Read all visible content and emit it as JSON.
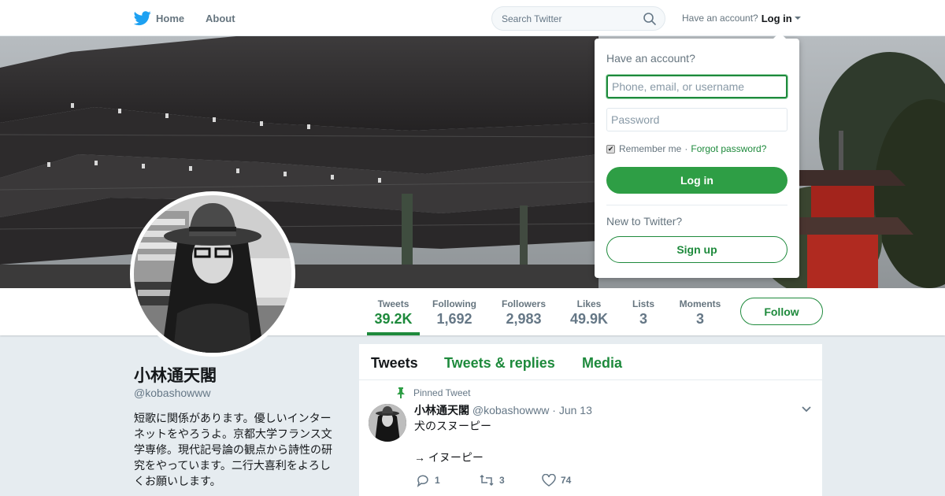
{
  "nav": {
    "home_label": "Home",
    "about_label": "About",
    "search_placeholder": "Search Twitter",
    "have_account": "Have an account?",
    "login_label": "Log in"
  },
  "profile_nav": {
    "stats": [
      {
        "label": "Tweets",
        "value": "39.2K"
      },
      {
        "label": "Following",
        "value": "1,692"
      },
      {
        "label": "Followers",
        "value": "2,983"
      },
      {
        "label": "Likes",
        "value": "49.9K"
      },
      {
        "label": "Lists",
        "value": "3"
      },
      {
        "label": "Moments",
        "value": "3"
      }
    ],
    "follow_label": "Follow"
  },
  "profile": {
    "name": "小林通天閣",
    "handle": "@kobashowww",
    "bio": "短歌に関係があります。優しいインターネットをやろうよ。京都大学フランス文学専修。現代記号論の観点から詩性の研究をやっています。二行大喜利をよろしくお願いします。"
  },
  "timeline": {
    "tabs": [
      "Tweets",
      "Tweets & replies",
      "Media"
    ],
    "tweet": {
      "pinned_label": "Pinned Tweet",
      "fullname": "小林通天閣",
      "handle": "@kobashowww",
      "dot": "·",
      "date": "Jun 13",
      "lines": [
        "犬のスヌーピー",
        "",
        "→ イヌーピー"
      ],
      "reply_count": "1",
      "retweet_count": "3",
      "like_count": "74"
    }
  },
  "login_dropdown": {
    "title": "Have an account?",
    "username_placeholder": "Phone, email, or username",
    "password_placeholder": "Password",
    "remember_label": "Remember me",
    "separator": "·",
    "forgot_label": "Forgot password?",
    "login_button": "Log in",
    "new_label": "New to Twitter?",
    "signup_button": "Sign up"
  },
  "colors": {
    "accent": "#1e8a3c",
    "login_button_bg": "#2e9e45",
    "page_bg": "#e6ecf0"
  }
}
